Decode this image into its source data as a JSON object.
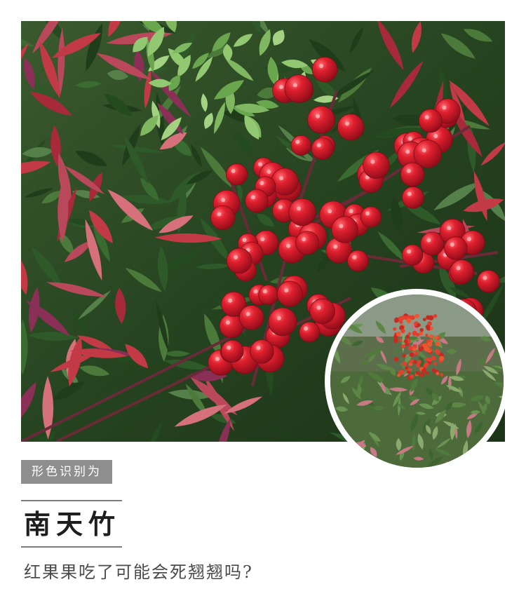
{
  "tag_label": "形色识别为",
  "plant_name": "南天竹",
  "question": "红果果吃了可能会死翘翘吗?",
  "photo": {
    "subject": "nandina-berries",
    "colors": {
      "berry": "#c8182a",
      "leaf_green": "#3f7a33",
      "leaf_red": "#c23a45",
      "background": "#223a1f"
    }
  }
}
